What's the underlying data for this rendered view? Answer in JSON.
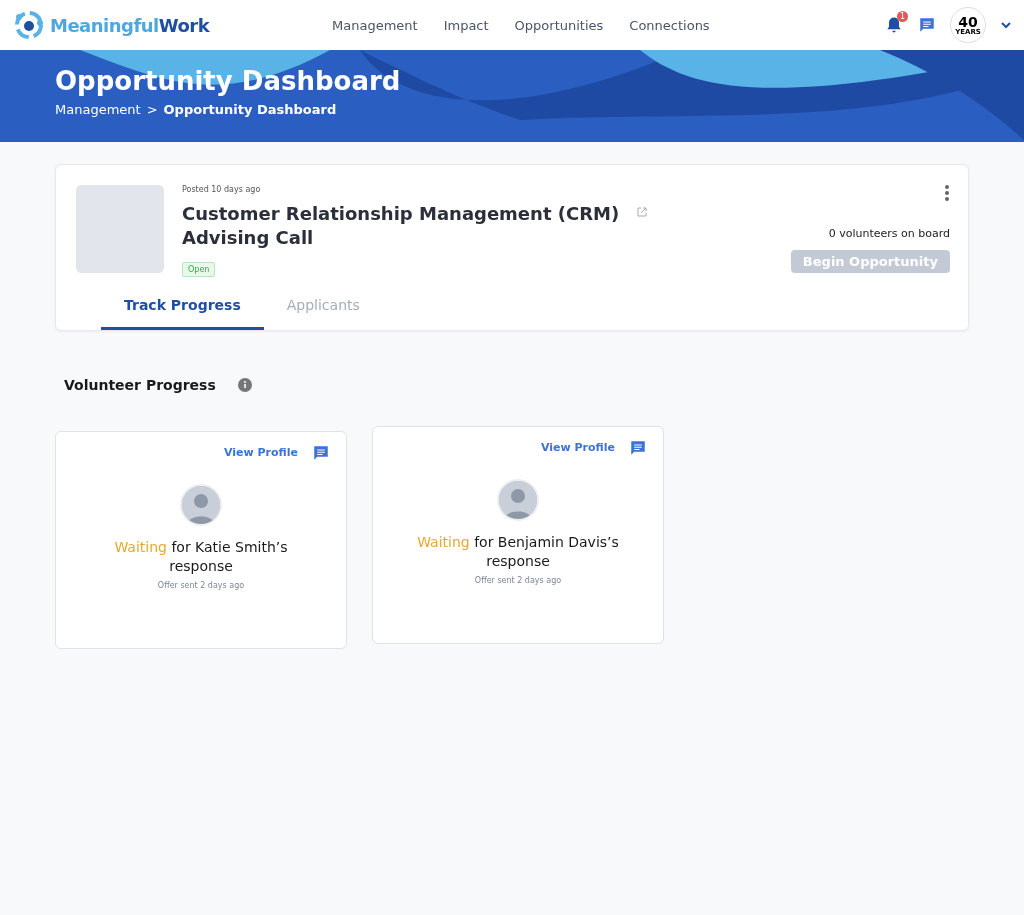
{
  "header": {
    "brand": [
      "Meaningful",
      "Work"
    ],
    "nav": [
      "Management",
      "Impact",
      "Opportunities",
      "Connections"
    ],
    "notification_count": "1",
    "account_logo": [
      "40",
      "YEARS"
    ]
  },
  "banner": {
    "title": "Opportunity Dashboard",
    "breadcrumb": [
      "Management",
      "Opportunity Dashboard"
    ],
    "separator": ">"
  },
  "opportunity": {
    "posted": "Posted 10 days ago",
    "title": "Customer Relationship Management (CRM) Advising Call",
    "status": "Open",
    "volunteers": "0 volunteers on board",
    "action": {
      "label": "Begin Opportunity",
      "disabled": true
    },
    "tabs": [
      {
        "label": "Track Progress",
        "selected": true
      },
      {
        "label": "Applicants",
        "selected": false
      }
    ]
  },
  "volunteer_progress": {
    "heading": "Volunteer Progress",
    "cards": [
      {
        "link": "View Profile",
        "status": "Waiting",
        "message": "for Katie Smith’s response",
        "sent": "Offer sent 2 days ago"
      },
      {
        "link": "View Profile",
        "status": "Waiting",
        "message": "for Benjamin Davis’s response",
        "sent": "Offer sent 2 days ago"
      }
    ]
  }
}
